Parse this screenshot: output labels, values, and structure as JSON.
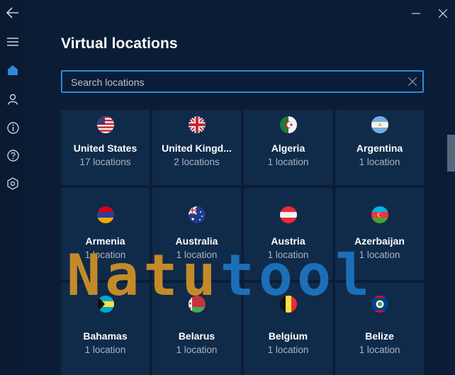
{
  "window": {
    "controls": [
      "minimize-icon",
      "close-icon"
    ]
  },
  "nav": {
    "back_icon": "back-arrow-icon",
    "items": [
      "menu-icon",
      "home-icon",
      "account-icon",
      "info-icon",
      "help-icon",
      "settings-icon"
    ],
    "active": "home-icon"
  },
  "page": {
    "title": "Virtual locations"
  },
  "search": {
    "placeholder": "Search locations",
    "value": ""
  },
  "locations": [
    {
      "name": "United States",
      "count": "17 locations",
      "flag": "us-flag-icon"
    },
    {
      "name": "United Kingd...",
      "count": "2 locations",
      "flag": "uk-flag-icon"
    },
    {
      "name": "Algeria",
      "count": "1 location",
      "flag": "dz-flag-icon"
    },
    {
      "name": "Argentina",
      "count": "1 location",
      "flag": "ar-flag-icon"
    },
    {
      "name": "Armenia",
      "count": "1 location",
      "flag": "am-flag-icon"
    },
    {
      "name": "Australia",
      "count": "1 location",
      "flag": "au-flag-icon"
    },
    {
      "name": "Austria",
      "count": "1 location",
      "flag": "at-flag-icon"
    },
    {
      "name": "Azerbaijan",
      "count": "1 location",
      "flag": "az-flag-icon"
    },
    {
      "name": "Bahamas",
      "count": "1 location",
      "flag": "bs-flag-icon"
    },
    {
      "name": "Belarus",
      "count": "1 location",
      "flag": "by-flag-icon"
    },
    {
      "name": "Belgium",
      "count": "1 location",
      "flag": "be-flag-icon"
    },
    {
      "name": "Belize",
      "count": "1 location",
      "flag": "bz-flag-icon"
    }
  ],
  "watermark": {
    "part1": "Natu",
    "part2": "tool"
  },
  "colors": {
    "background": "#0b1d36",
    "tile": "#102a4a",
    "accent": "#2d8ad8",
    "secondary_text": "#a9b4c4"
  }
}
